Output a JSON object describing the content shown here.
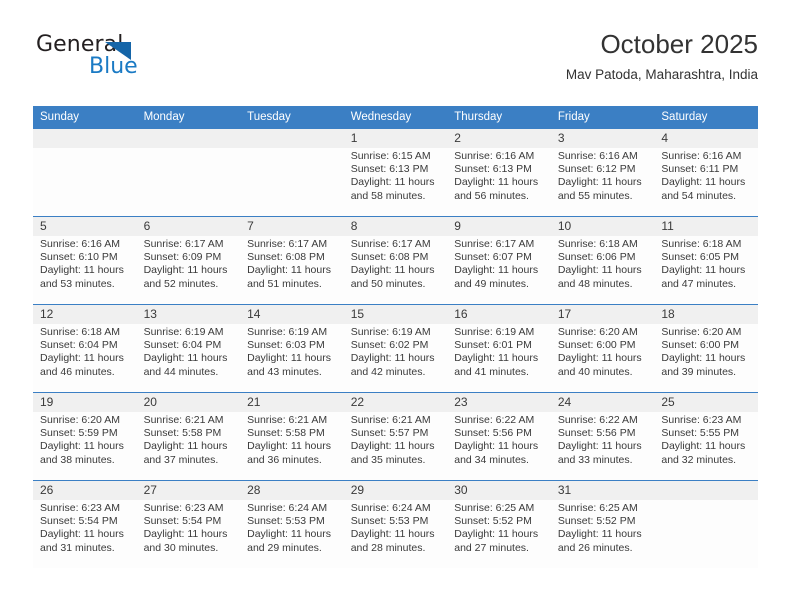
{
  "brand": {
    "name_part1": "General",
    "name_part2": "Blue",
    "flag_color": "#1565a8",
    "accent_color": "#1a7ac4"
  },
  "header": {
    "title": "October 2025",
    "subtitle": "Mav Patoda, Maharashtra, India"
  },
  "theme": {
    "header_blue": "#3b7fc4",
    "daynum_band": "#f0f0f0",
    "cell_bg": "#fdfdfd",
    "text": "#3a3a3a"
  },
  "calendar": {
    "weekday_headers": [
      "Sunday",
      "Monday",
      "Tuesday",
      "Wednesday",
      "Thursday",
      "Friday",
      "Saturday"
    ],
    "weeks": [
      {
        "days": [
          {
            "num": "",
            "empty": true,
            "l1": "",
            "l2": "",
            "l3": "",
            "l4": ""
          },
          {
            "num": "",
            "empty": true,
            "l1": "",
            "l2": "",
            "l3": "",
            "l4": ""
          },
          {
            "num": "",
            "empty": true,
            "l1": "",
            "l2": "",
            "l3": "",
            "l4": ""
          },
          {
            "num": "1",
            "empty": false,
            "l1": "Sunrise: 6:15 AM",
            "l2": "Sunset: 6:13 PM",
            "l3": "Daylight: 11 hours",
            "l4": "and 58 minutes."
          },
          {
            "num": "2",
            "empty": false,
            "l1": "Sunrise: 6:16 AM",
            "l2": "Sunset: 6:13 PM",
            "l3": "Daylight: 11 hours",
            "l4": "and 56 minutes."
          },
          {
            "num": "3",
            "empty": false,
            "l1": "Sunrise: 6:16 AM",
            "l2": "Sunset: 6:12 PM",
            "l3": "Daylight: 11 hours",
            "l4": "and 55 minutes."
          },
          {
            "num": "4",
            "empty": false,
            "l1": "Sunrise: 6:16 AM",
            "l2": "Sunset: 6:11 PM",
            "l3": "Daylight: 11 hours",
            "l4": "and 54 minutes."
          }
        ]
      },
      {
        "days": [
          {
            "num": "5",
            "empty": false,
            "l1": "Sunrise: 6:16 AM",
            "l2": "Sunset: 6:10 PM",
            "l3": "Daylight: 11 hours",
            "l4": "and 53 minutes."
          },
          {
            "num": "6",
            "empty": false,
            "l1": "Sunrise: 6:17 AM",
            "l2": "Sunset: 6:09 PM",
            "l3": "Daylight: 11 hours",
            "l4": "and 52 minutes."
          },
          {
            "num": "7",
            "empty": false,
            "l1": "Sunrise: 6:17 AM",
            "l2": "Sunset: 6:08 PM",
            "l3": "Daylight: 11 hours",
            "l4": "and 51 minutes."
          },
          {
            "num": "8",
            "empty": false,
            "l1": "Sunrise: 6:17 AM",
            "l2": "Sunset: 6:08 PM",
            "l3": "Daylight: 11 hours",
            "l4": "and 50 minutes."
          },
          {
            "num": "9",
            "empty": false,
            "l1": "Sunrise: 6:17 AM",
            "l2": "Sunset: 6:07 PM",
            "l3": "Daylight: 11 hours",
            "l4": "and 49 minutes."
          },
          {
            "num": "10",
            "empty": false,
            "l1": "Sunrise: 6:18 AM",
            "l2": "Sunset: 6:06 PM",
            "l3": "Daylight: 11 hours",
            "l4": "and 48 minutes."
          },
          {
            "num": "11",
            "empty": false,
            "l1": "Sunrise: 6:18 AM",
            "l2": "Sunset: 6:05 PM",
            "l3": "Daylight: 11 hours",
            "l4": "and 47 minutes."
          }
        ]
      },
      {
        "days": [
          {
            "num": "12",
            "empty": false,
            "l1": "Sunrise: 6:18 AM",
            "l2": "Sunset: 6:04 PM",
            "l3": "Daylight: 11 hours",
            "l4": "and 46 minutes."
          },
          {
            "num": "13",
            "empty": false,
            "l1": "Sunrise: 6:19 AM",
            "l2": "Sunset: 6:04 PM",
            "l3": "Daylight: 11 hours",
            "l4": "and 44 minutes."
          },
          {
            "num": "14",
            "empty": false,
            "l1": "Sunrise: 6:19 AM",
            "l2": "Sunset: 6:03 PM",
            "l3": "Daylight: 11 hours",
            "l4": "and 43 minutes."
          },
          {
            "num": "15",
            "empty": false,
            "l1": "Sunrise: 6:19 AM",
            "l2": "Sunset: 6:02 PM",
            "l3": "Daylight: 11 hours",
            "l4": "and 42 minutes."
          },
          {
            "num": "16",
            "empty": false,
            "l1": "Sunrise: 6:19 AM",
            "l2": "Sunset: 6:01 PM",
            "l3": "Daylight: 11 hours",
            "l4": "and 41 minutes."
          },
          {
            "num": "17",
            "empty": false,
            "l1": "Sunrise: 6:20 AM",
            "l2": "Sunset: 6:00 PM",
            "l3": "Daylight: 11 hours",
            "l4": "and 40 minutes."
          },
          {
            "num": "18",
            "empty": false,
            "l1": "Sunrise: 6:20 AM",
            "l2": "Sunset: 6:00 PM",
            "l3": "Daylight: 11 hours",
            "l4": "and 39 minutes."
          }
        ]
      },
      {
        "days": [
          {
            "num": "19",
            "empty": false,
            "l1": "Sunrise: 6:20 AM",
            "l2": "Sunset: 5:59 PM",
            "l3": "Daylight: 11 hours",
            "l4": "and 38 minutes."
          },
          {
            "num": "20",
            "empty": false,
            "l1": "Sunrise: 6:21 AM",
            "l2": "Sunset: 5:58 PM",
            "l3": "Daylight: 11 hours",
            "l4": "and 37 minutes."
          },
          {
            "num": "21",
            "empty": false,
            "l1": "Sunrise: 6:21 AM",
            "l2": "Sunset: 5:58 PM",
            "l3": "Daylight: 11 hours",
            "l4": "and 36 minutes."
          },
          {
            "num": "22",
            "empty": false,
            "l1": "Sunrise: 6:21 AM",
            "l2": "Sunset: 5:57 PM",
            "l3": "Daylight: 11 hours",
            "l4": "and 35 minutes."
          },
          {
            "num": "23",
            "empty": false,
            "l1": "Sunrise: 6:22 AM",
            "l2": "Sunset: 5:56 PM",
            "l3": "Daylight: 11 hours",
            "l4": "and 34 minutes."
          },
          {
            "num": "24",
            "empty": false,
            "l1": "Sunrise: 6:22 AM",
            "l2": "Sunset: 5:56 PM",
            "l3": "Daylight: 11 hours",
            "l4": "and 33 minutes."
          },
          {
            "num": "25",
            "empty": false,
            "l1": "Sunrise: 6:23 AM",
            "l2": "Sunset: 5:55 PM",
            "l3": "Daylight: 11 hours",
            "l4": "and 32 minutes."
          }
        ]
      },
      {
        "days": [
          {
            "num": "26",
            "empty": false,
            "l1": "Sunrise: 6:23 AM",
            "l2": "Sunset: 5:54 PM",
            "l3": "Daylight: 11 hours",
            "l4": "and 31 minutes."
          },
          {
            "num": "27",
            "empty": false,
            "l1": "Sunrise: 6:23 AM",
            "l2": "Sunset: 5:54 PM",
            "l3": "Daylight: 11 hours",
            "l4": "and 30 minutes."
          },
          {
            "num": "28",
            "empty": false,
            "l1": "Sunrise: 6:24 AM",
            "l2": "Sunset: 5:53 PM",
            "l3": "Daylight: 11 hours",
            "l4": "and 29 minutes."
          },
          {
            "num": "29",
            "empty": false,
            "l1": "Sunrise: 6:24 AM",
            "l2": "Sunset: 5:53 PM",
            "l3": "Daylight: 11 hours",
            "l4": "and 28 minutes."
          },
          {
            "num": "30",
            "empty": false,
            "l1": "Sunrise: 6:25 AM",
            "l2": "Sunset: 5:52 PM",
            "l3": "Daylight: 11 hours",
            "l4": "and 27 minutes."
          },
          {
            "num": "31",
            "empty": false,
            "l1": "Sunrise: 6:25 AM",
            "l2": "Sunset: 5:52 PM",
            "l3": "Daylight: 11 hours",
            "l4": "and 26 minutes."
          },
          {
            "num": "",
            "empty": true,
            "l1": "",
            "l2": "",
            "l3": "",
            "l4": ""
          }
        ]
      }
    ]
  }
}
